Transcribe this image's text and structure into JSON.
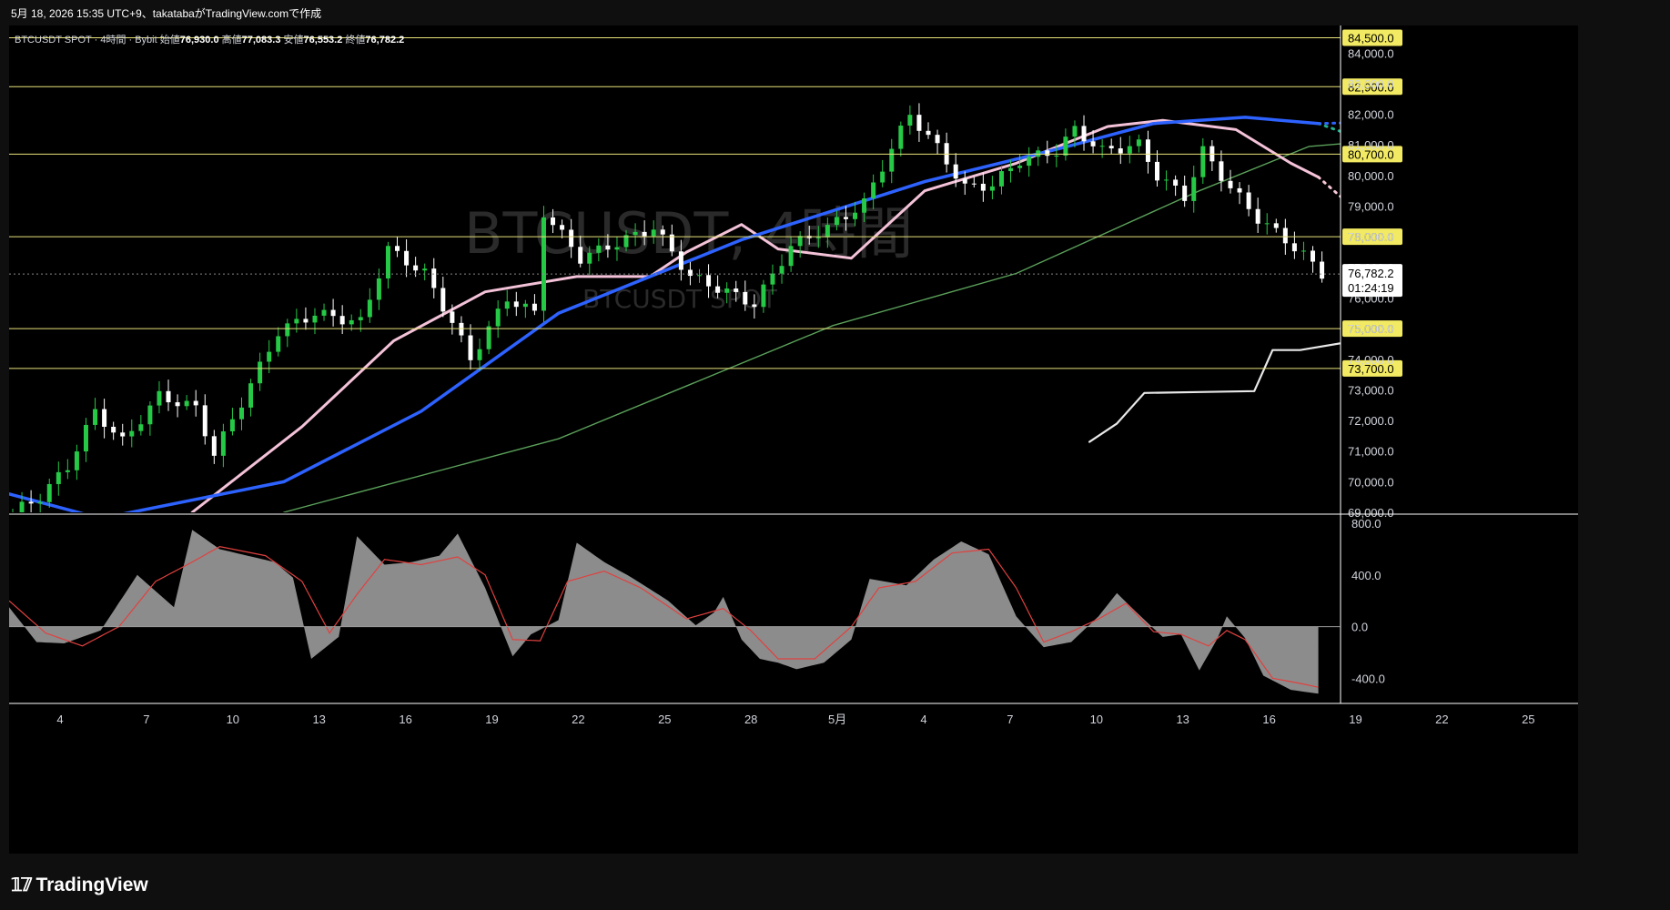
{
  "header": {
    "caption": "5月 18, 2026 15:35 UTC+9、takatabaがTradingView.comで作成"
  },
  "symbol_info": {
    "name": "BTCUSDT SPOT · 4時間 · Bybit",
    "open_label": "始値",
    "open": "76,930.0",
    "high_label": "高値",
    "high": "77,083.3",
    "low_label": "安値",
    "low": "76,553.2",
    "close_label": "終値",
    "close": "76,782.2"
  },
  "watermark": {
    "line1": "BTCUSDT, 4時間",
    "line2": "BTCUSDT SPOT"
  },
  "footer": {
    "logo": "TradingView"
  },
  "colors": {
    "background": "#000000",
    "up_candle": "#26c946",
    "down_candle": "#ffffff",
    "sma_long": "#2d62ff",
    "sma_mid": "#f4c2d8",
    "horizontal_level": "#e8e27a",
    "bollinger": "#3f7ad6",
    "histogram": "#8c8c8c",
    "signal": "#e0413f"
  },
  "chart_data": [
    {
      "type": "candlestick",
      "title": "BTCUSDT SPOT · 4時間 · Bybit",
      "x_tick_labels": [
        "4",
        "7",
        "10",
        "13",
        "16",
        "19",
        "22",
        "25",
        "28",
        "5月",
        "4",
        "7",
        "10",
        "13",
        "16",
        "19",
        "22",
        "25"
      ],
      "y_ticks": [
        69000,
        70000,
        71000,
        72000,
        73000,
        74000,
        75000,
        76000,
        77000,
        78000,
        79000,
        80000,
        81000,
        82000,
        83000,
        84000
      ],
      "y_tick_labels": [
        "69,000.0",
        "70,000.0",
        "71,000.0",
        "72,000.0",
        "73,000.0",
        "74,000.0",
        "75,000.0",
        "76,000.0",
        "77,000.0",
        "78,000.0",
        "79,000.0",
        "80,000.0",
        "81,000.0",
        "82,000.0",
        "83,000.0",
        "84,000.0"
      ],
      "ylim": [
        69000,
        84900
      ],
      "price_label": {
        "value": "76,782.2",
        "countdown": "01:24:19"
      },
      "horizontal_levels": [
        {
          "value": 84500,
          "label": "84,500.0"
        },
        {
          "value": 82900,
          "label": "82,900.0"
        },
        {
          "value": 80700,
          "label": "80,700.0"
        },
        {
          "value": 78000,
          "label": "78,000.0"
        },
        {
          "value": 75000,
          "label": "75,000.0"
        },
        {
          "value": 73700,
          "label": "73,700.0"
        }
      ],
      "candle_anchors": [
        [
          0,
          69000
        ],
        [
          3,
          69500
        ],
        [
          6,
          70500
        ],
        [
          9,
          72300
        ],
        [
          12,
          71300
        ],
        [
          16,
          72800
        ],
        [
          20,
          72400
        ],
        [
          22,
          70900
        ],
        [
          25,
          72600
        ],
        [
          29,
          74900
        ],
        [
          33,
          75500
        ],
        [
          38,
          75200
        ],
        [
          41,
          77600
        ],
        [
          45,
          76800
        ],
        [
          48,
          75200
        ],
        [
          50,
          74000
        ],
        [
          54,
          76000
        ],
        [
          57,
          75500
        ],
        [
          58,
          78800
        ],
        [
          62,
          77300
        ],
        [
          66,
          77800
        ],
        [
          70,
          78300
        ],
        [
          74,
          76700
        ],
        [
          78,
          76200
        ],
        [
          81,
          75800
        ],
        [
          85,
          77700
        ],
        [
          89,
          78300
        ],
        [
          93,
          79100
        ],
        [
          96,
          80900
        ],
        [
          98,
          82000
        ],
        [
          101,
          80900
        ],
        [
          104,
          79600
        ],
        [
          107,
          79700
        ],
        [
          110,
          80500
        ],
        [
          114,
          80800
        ],
        [
          116,
          81500
        ],
        [
          119,
          80800
        ],
        [
          123,
          81000
        ],
        [
          125,
          80000
        ],
        [
          128,
          79300
        ],
        [
          130,
          80800
        ],
        [
          133,
          79600
        ],
        [
          136,
          78600
        ],
        [
          139,
          77900
        ],
        [
          141,
          77400
        ],
        [
          143,
          76800
        ]
      ],
      "series": [
        {
          "name": "",
          "style": "solid",
          "points": [
            [
              30,
              69000
            ],
            [
              60,
              71400
            ],
            [
              90,
              75100
            ],
            [
              110,
              76800
            ],
            [
              130,
              79500
            ],
            [
              142,
              80950
            ],
            [
              150,
              81150
            ],
            [
              160,
              81000
            ],
            [
              170,
              80650
            ]
          ]
        },
        {
          "name": "",
          "style": "solid",
          "points": [
            [
              20,
              69000
            ],
            [
              32,
              71800
            ],
            [
              42,
              74600
            ],
            [
              52,
              76200
            ],
            [
              62,
              76700
            ],
            [
              70,
              76700
            ],
            [
              74,
              77500
            ],
            [
              80,
              78400
            ],
            [
              84,
              77600
            ],
            [
              92,
              77300
            ],
            [
              100,
              79500
            ],
            [
              110,
              80400
            ],
            [
              120,
              81600
            ],
            [
              126,
              81800
            ],
            [
              134,
              81500
            ],
            [
              140,
              80400
            ],
            [
              143,
              79950
            ]
          ]
        },
        {
          "name": "",
          "style": "solid",
          "points": [
            [
              0,
              69600
            ],
            [
              10,
              68800
            ],
            [
              30,
              70000
            ],
            [
              45,
              72300
            ],
            [
              60,
              75500
            ],
            [
              80,
              77900
            ],
            [
              100,
              79800
            ],
            [
              115,
              80900
            ],
            [
              125,
              81700
            ],
            [
              135,
              81900
            ],
            [
              143,
              81700
            ]
          ]
        },
        {
          "name": "",
          "style": "solid",
          "points": [
            [
              118,
              71300
            ],
            [
              121,
              71900
            ],
            [
              124,
              72900
            ],
            [
              130,
              72930
            ],
            [
              136,
              72960
            ],
            [
              138,
              74300
            ],
            [
              141,
              74300
            ],
            [
              146,
              74550
            ],
            [
              150,
              74600
            ],
            [
              154,
              74550
            ],
            [
              158,
              74950
            ],
            [
              162,
              74950
            ],
            [
              165,
              75200
            ],
            [
              170,
              75200
            ]
          ]
        },
        {
          "name": "",
          "style": "dotted",
          "points": [
            [
              143,
              79950
            ],
            [
              155,
              76800
            ]
          ]
        },
        {
          "name": "",
          "style": "dotted",
          "points": [
            [
              143,
              81700
            ],
            [
              151,
              80850
            ],
            [
              159,
              79800
            ],
            [
              165,
              78600
            ]
          ]
        },
        {
          "name": "",
          "style": "dotted",
          "points": [
            [
              143,
              81700
            ],
            [
              150,
              81750
            ],
            [
              158,
              81500
            ],
            [
              166,
              81100
            ],
            [
              170,
              81000
            ]
          ]
        }
      ]
    },
    {
      "type": "area",
      "y_ticks": [
        -400,
        0,
        400,
        800
      ],
      "y_tick_labels": [
        "-400.0",
        "0.0",
        "400.0",
        "800.0"
      ],
      "ylim": [
        -560,
        850
      ],
      "histogram_anchors": [
        [
          0,
          150
        ],
        [
          3,
          -120
        ],
        [
          6,
          -130
        ],
        [
          10,
          -30
        ],
        [
          14,
          400
        ],
        [
          18,
          150
        ],
        [
          20,
          750
        ],
        [
          23,
          600
        ],
        [
          26,
          550
        ],
        [
          29,
          500
        ],
        [
          31,
          380
        ],
        [
          33,
          -250
        ],
        [
          36,
          -80
        ],
        [
          38,
          700
        ],
        [
          41,
          480
        ],
        [
          44,
          500
        ],
        [
          47,
          550
        ],
        [
          49,
          720
        ],
        [
          52,
          300
        ],
        [
          55,
          -230
        ],
        [
          57,
          -60
        ],
        [
          60,
          50
        ],
        [
          62,
          650
        ],
        [
          65,
          500
        ],
        [
          68,
          380
        ],
        [
          72,
          200
        ],
        [
          75,
          10
        ],
        [
          77,
          110
        ],
        [
          78,
          230
        ],
        [
          80,
          -100
        ],
        [
          82,
          -250
        ],
        [
          84,
          -280
        ],
        [
          86,
          -330
        ],
        [
          89,
          -280
        ],
        [
          92,
          -100
        ],
        [
          94,
          370
        ],
        [
          98,
          320
        ],
        [
          101,
          520
        ],
        [
          104,
          660
        ],
        [
          107,
          560
        ],
        [
          110,
          80
        ],
        [
          113,
          -160
        ],
        [
          116,
          -120
        ],
        [
          119,
          80
        ],
        [
          121,
          260
        ],
        [
          123,
          120
        ],
        [
          126,
          -80
        ],
        [
          128,
          -60
        ],
        [
          130,
          -340
        ],
        [
          132,
          -90
        ],
        [
          133,
          80
        ],
        [
          135,
          -90
        ],
        [
          137,
          -380
        ],
        [
          140,
          -490
        ],
        [
          143,
          -520
        ]
      ],
      "signal_anchors": [
        [
          0,
          200
        ],
        [
          4,
          -50
        ],
        [
          8,
          -150
        ],
        [
          12,
          0
        ],
        [
          16,
          350
        ],
        [
          20,
          500
        ],
        [
          23,
          620
        ],
        [
          28,
          550
        ],
        [
          32,
          350
        ],
        [
          35,
          -50
        ],
        [
          38,
          250
        ],
        [
          41,
          520
        ],
        [
          45,
          480
        ],
        [
          49,
          540
        ],
        [
          52,
          400
        ],
        [
          55,
          -100
        ],
        [
          58,
          -110
        ],
        [
          61,
          350
        ],
        [
          65,
          430
        ],
        [
          69,
          300
        ],
        [
          74,
          60
        ],
        [
          78,
          140
        ],
        [
          81,
          -30
        ],
        [
          84,
          -250
        ],
        [
          88,
          -250
        ],
        [
          92,
          0
        ],
        [
          95,
          300
        ],
        [
          99,
          350
        ],
        [
          103,
          570
        ],
        [
          107,
          600
        ],
        [
          110,
          300
        ],
        [
          113,
          -120
        ],
        [
          116,
          -40
        ],
        [
          119,
          60
        ],
        [
          122,
          180
        ],
        [
          125,
          -40
        ],
        [
          128,
          -60
        ],
        [
          131,
          -150
        ],
        [
          133,
          -30
        ],
        [
          135,
          -100
        ],
        [
          138,
          -400
        ],
        [
          141,
          -440
        ],
        [
          143,
          -470
        ]
      ]
    }
  ]
}
